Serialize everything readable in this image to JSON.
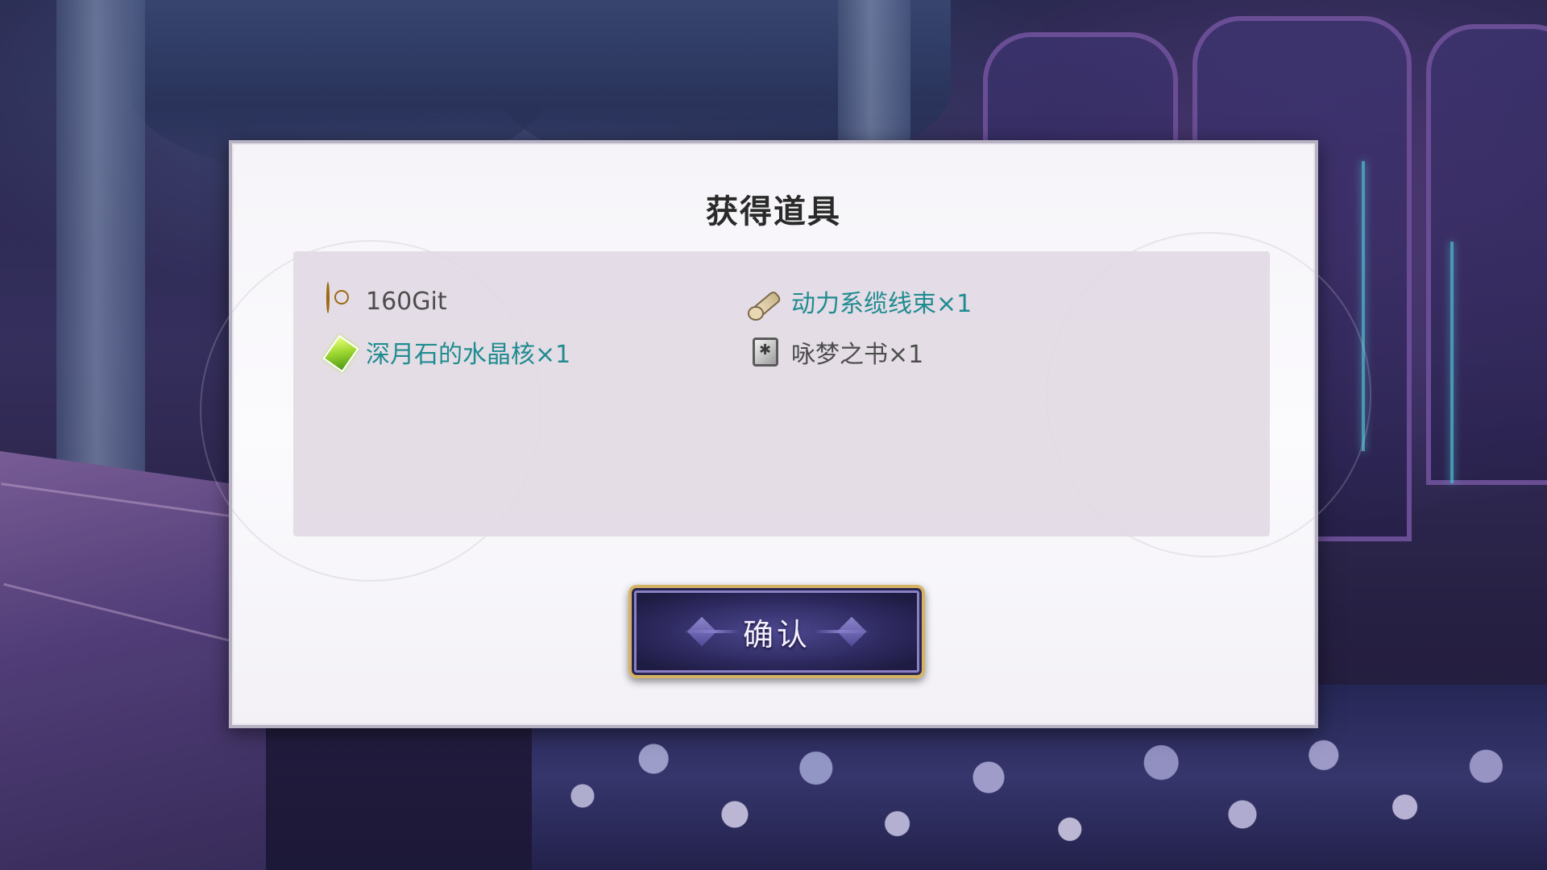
{
  "dialog": {
    "title": "获得道具",
    "items": [
      {
        "name": "160Git",
        "icon": "coin-icon",
        "rare": false
      },
      {
        "name": "动力系缆线束×1",
        "icon": "cable-icon",
        "rare": true
      },
      {
        "name": "深月石的水晶核×1",
        "icon": "crystal-icon",
        "rare": true
      },
      {
        "name": "咏梦之书×1",
        "icon": "book-icon",
        "rare": false
      }
    ],
    "confirm_label": "确认"
  },
  "colors": {
    "rare_item_text": "#1f8c90",
    "normal_item_text": "#4d4d4d",
    "button_border": "#d4b464",
    "button_fill": "#2e2a60"
  }
}
